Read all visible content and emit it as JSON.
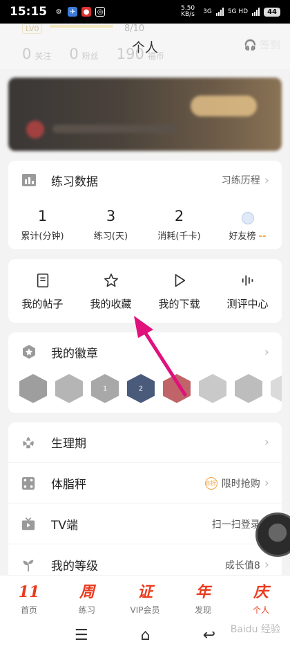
{
  "status_bar": {
    "time": "15:15",
    "net_speed": "5.50 KB/s",
    "net_type": "3G",
    "net_type2": "5G HD",
    "battery": "44"
  },
  "header": {
    "level": "LV0",
    "level_progress": "8/10",
    "page_title": "个人",
    "stats": [
      {
        "num": "0",
        "label": "关注"
      },
      {
        "num": "0",
        "label": "粉丝"
      },
      {
        "num": "190",
        "label": "福币"
      }
    ],
    "signin_label": "签到"
  },
  "practice": {
    "title": "练习数据",
    "history_link": "习练历程",
    "stats": [
      {
        "value": "1",
        "label": "累计(分钟)"
      },
      {
        "value": "3",
        "label": "练习(天)"
      },
      {
        "value": "2",
        "label": "消耗(千卡)"
      },
      {
        "value": "",
        "label": "好友榜",
        "suffix": "--"
      }
    ]
  },
  "shortcuts": [
    {
      "label": "我的帖子",
      "icon": "document-icon"
    },
    {
      "label": "我的收藏",
      "icon": "star-icon"
    },
    {
      "label": "我的下载",
      "icon": "play-icon"
    },
    {
      "label": "测评中心",
      "icon": "audio-bars-icon"
    }
  ],
  "badges": {
    "title": "我的徽章",
    "items": [
      {
        "text": "",
        "color": "#9e9e9e"
      },
      {
        "text": "",
        "color": "#b5b5b5"
      },
      {
        "text": "1",
        "color": "#a8a8a8"
      },
      {
        "text": "2",
        "color": "#4a5a7a"
      },
      {
        "text": "",
        "color": "#c0646a"
      },
      {
        "text": "",
        "color": "#c9c9c9"
      },
      {
        "text": "",
        "color": "#bdbdbd"
      },
      {
        "text": "",
        "color": "#dadada"
      }
    ]
  },
  "menu": [
    {
      "title": "生理期",
      "right": "",
      "icon": "flower-icon"
    },
    {
      "title": "体脂秤",
      "right": "限时抢购",
      "discount": "8折",
      "icon": "scale-icon"
    },
    {
      "title": "TV端",
      "right": "扫一扫登录",
      "icon": "tv-icon"
    },
    {
      "title": "我的等级",
      "right": "成长值8",
      "icon": "sprout-icon"
    }
  ],
  "bottom_nav": [
    {
      "glyph": "11",
      "label": "首页",
      "active": false
    },
    {
      "glyph": "周",
      "label": "练习",
      "active": false
    },
    {
      "glyph": "证",
      "label": "VIP会员",
      "active": false
    },
    {
      "glyph": "年",
      "label": "发现",
      "active": false
    },
    {
      "glyph": "庆",
      "label": "个人",
      "active": true
    }
  ],
  "watermark": "Baidu 经验",
  "colors": {
    "accent": "#ea3b1f",
    "annotation_arrow": "#e0107c",
    "badge_discount": "#f2a341"
  }
}
